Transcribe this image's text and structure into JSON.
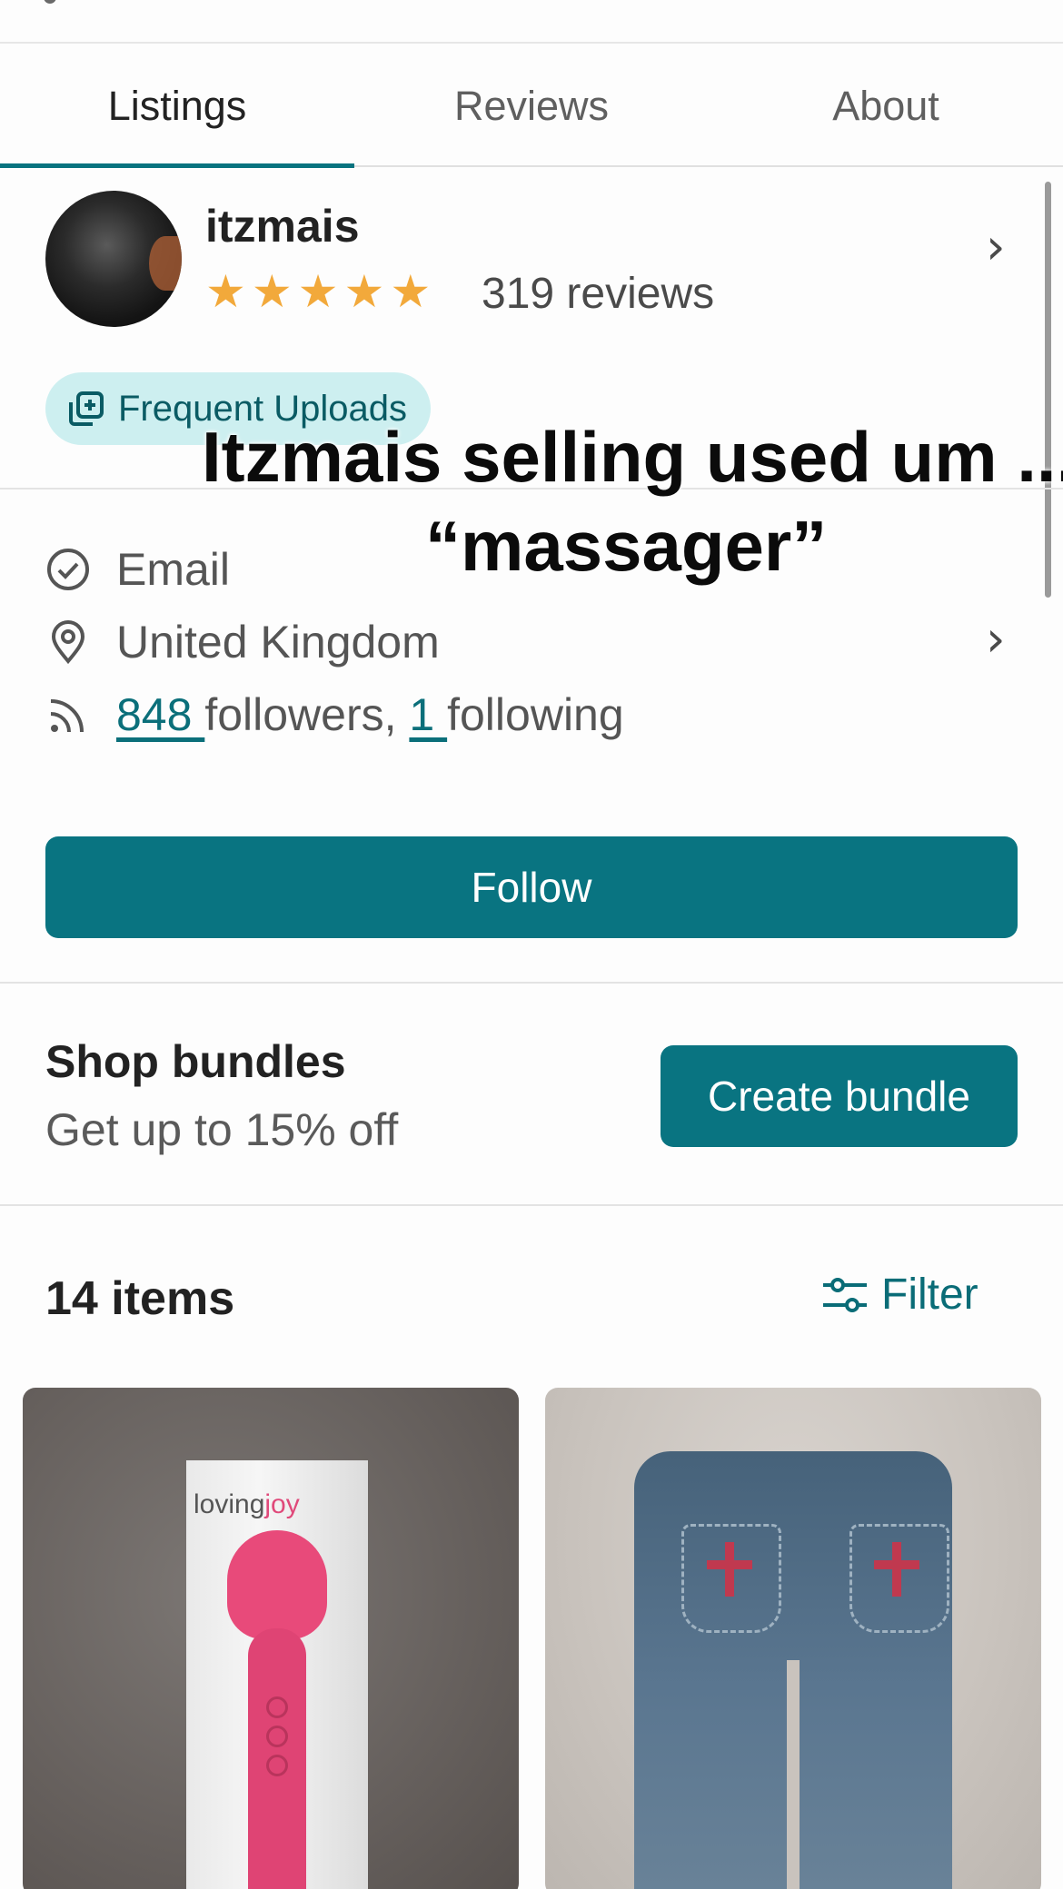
{
  "tabs": [
    {
      "label": "Listings",
      "active": true
    },
    {
      "label": "Reviews",
      "active": false
    },
    {
      "label": "About",
      "active": false
    }
  ],
  "profile": {
    "username": "itzmais",
    "rating_stars": 5,
    "reviews_label": "319 reviews"
  },
  "badge": {
    "label": "Frequent Uploads",
    "icon": "frequent-uploads-icon"
  },
  "overlay_caption": {
    "line1": "Itzmais selling used um ...",
    "line2": "“massager”"
  },
  "info": {
    "verified": "Email",
    "location": "United Kingdom",
    "followers_count": "848 ",
    "followers_text": "followers, ",
    "following_count": "1 ",
    "following_text": "following"
  },
  "follow_button": "Follow",
  "bundles": {
    "title": "Shop bundles",
    "subtitle": "Get up to 15% off",
    "button": "Create bundle"
  },
  "listings_header": {
    "count_label": "14 items",
    "filter_label": "Filter"
  },
  "products": [
    {
      "name": "product-massager",
      "brand_a": "loving",
      "brand_b": "joy"
    },
    {
      "name": "product-jeans"
    }
  ],
  "colors": {
    "accent": "#097481",
    "star": "#f2a93b",
    "badge_bg": "#cdeff0"
  }
}
